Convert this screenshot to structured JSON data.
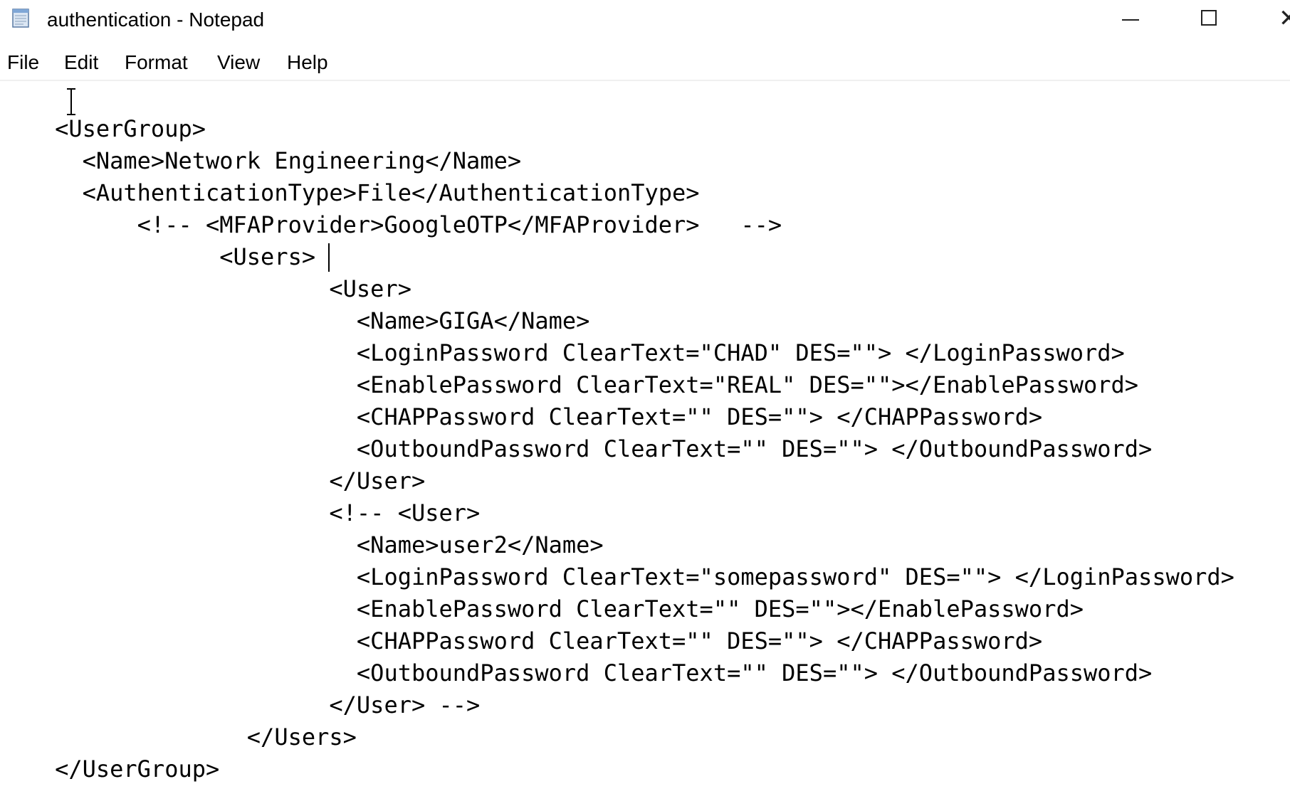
{
  "window": {
    "title": "authentication - Notepad",
    "icon": "notepad-icon",
    "controls": [
      "minimize-icon",
      "maximize-icon",
      "close-icon"
    ]
  },
  "menu": {
    "items": [
      "File",
      "Edit",
      "Format",
      "View",
      "Help"
    ]
  },
  "editor": {
    "lines": [
      "",
      "    <UserGroup>",
      "      <Name>Network Engineering</Name>",
      "      <AuthenticationType>File</AuthenticationType>",
      "          <!-- <MFAProvider>GoogleOTP</MFAProvider>   -->",
      "                <Users>",
      "                        <User>",
      "                          <Name>GIGA</Name>",
      "                          <LoginPassword ClearText=\"CHAD\" DES=\"\"> </LoginPassword>",
      "                          <EnablePassword ClearText=\"REAL\" DES=\"\"></EnablePassword>",
      "                          <CHAPPassword ClearText=\"\" DES=\"\"> </CHAPPassword>",
      "                          <OutboundPassword ClearText=\"\" DES=\"\"> </OutboundPassword>",
      "                        </User>",
      "                        <!-- <User>",
      "                          <Name>user2</Name>",
      "                          <LoginPassword ClearText=\"somepassword\" DES=\"\"> </LoginPassword>",
      "                          <EnablePassword ClearText=\"\" DES=\"\"></EnablePassword>",
      "                          <CHAPPassword ClearText=\"\" DES=\"\"> </CHAPPassword>",
      "                          <OutboundPassword ClearText=\"\" DES=\"\"> </OutboundPassword>",
      "                        </User> -->",
      "                  </Users>",
      "    </UserGroup>"
    ]
  }
}
